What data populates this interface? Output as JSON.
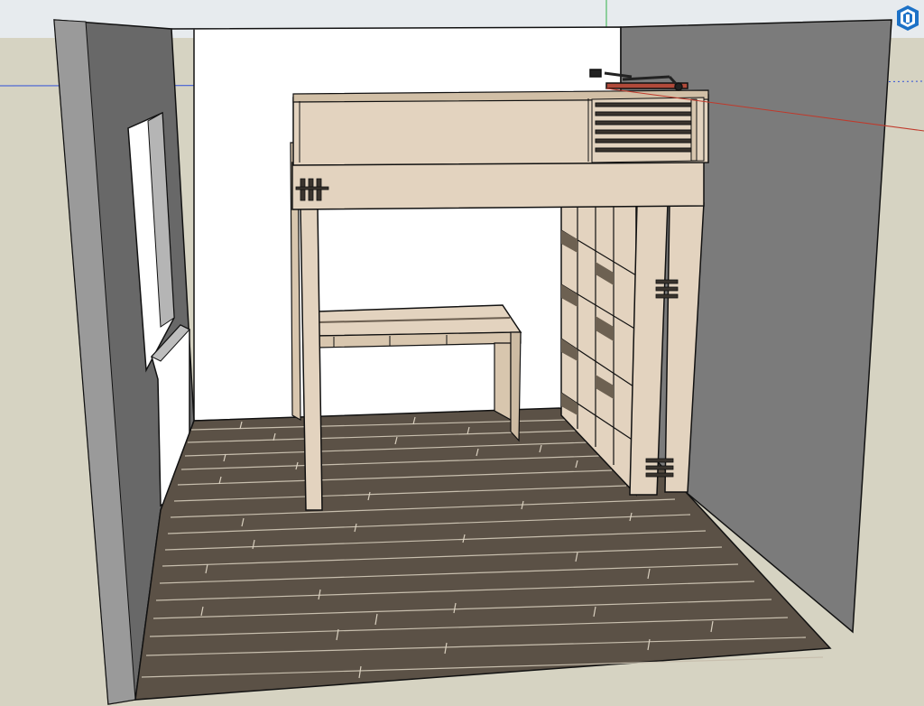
{
  "app": {
    "name": "SketchUp",
    "logo_icon": "sketchup-logo-icon"
  },
  "colors": {
    "sky": "#e7ebee",
    "ground": "#d6d3c2",
    "wall_left": "#6a6a6a",
    "wall_left_edge": "#9a9a9a",
    "wall_right": "#7b7b7b",
    "back_wall": "#ffffff",
    "floor_dark": "#5b5146",
    "floor_light": "#8a7f70",
    "wood": "#e3d3bf",
    "wood_dark": "#c9b79f",
    "outline": "#111111",
    "axis_red": "#c0392b",
    "axis_green": "#33b24a",
    "axis_blue": "#2f4fd8",
    "logo_blue": "#1d72c7"
  },
  "model": {
    "objects": [
      "room-left-wall",
      "room-right-wall",
      "room-back-wall",
      "wood-plank-floor",
      "window",
      "radiator",
      "loft-bed-frame",
      "bed-guard-rail",
      "ladder-rungs",
      "desk",
      "cube-bookshelf",
      "desk-lamp"
    ]
  }
}
